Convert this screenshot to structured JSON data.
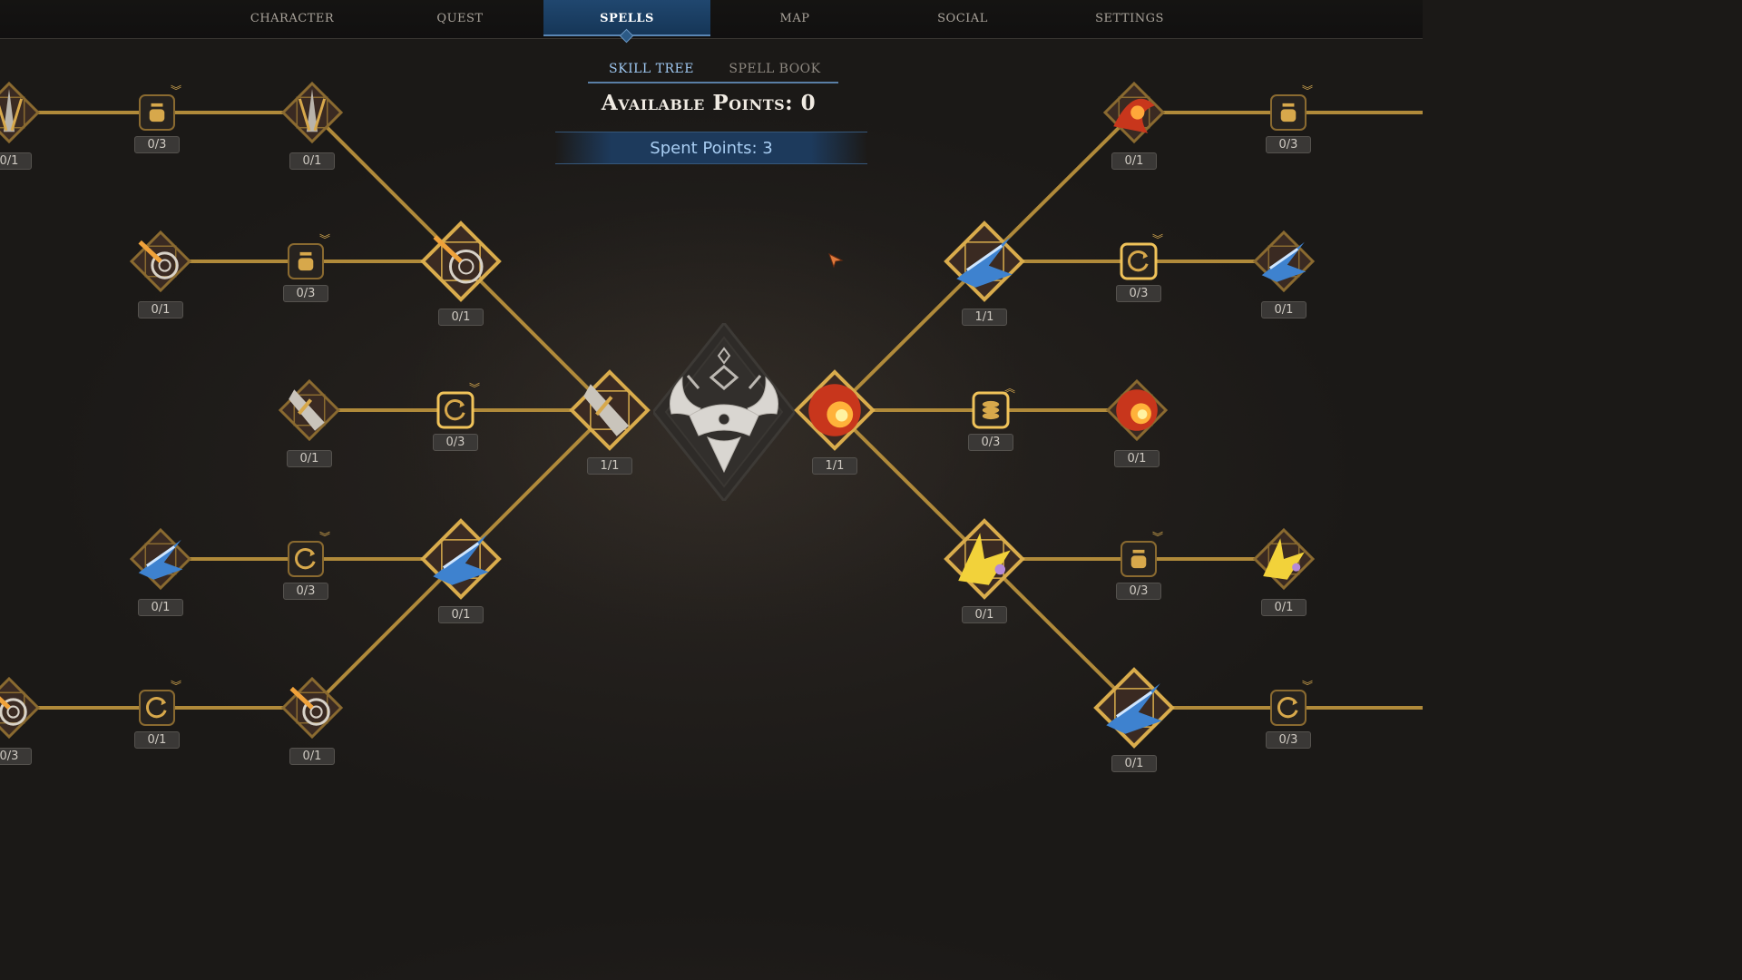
{
  "nav": {
    "tabs": [
      {
        "label": "CHARACTER",
        "active": false
      },
      {
        "label": "QUEST",
        "active": false
      },
      {
        "label": "SPELLS",
        "active": true
      },
      {
        "label": "MAP",
        "active": false
      },
      {
        "label": "SOCIAL",
        "active": false
      },
      {
        "label": "SETTINGS",
        "active": false
      }
    ]
  },
  "subtabs": [
    {
      "label": "SKILL TREE",
      "active": true
    },
    {
      "label": "SPELL BOOK",
      "active": false
    }
  ],
  "points": {
    "available_label": "Available Points: 0",
    "spent_label": "Spent Points: 3"
  },
  "colors": {
    "active_tab": "#1d3f63",
    "link": "#b08a3a",
    "gold": "#d7a84b",
    "fire": "#c8361c",
    "ice": "#3e82cf"
  },
  "nodes": {
    "l_top_edge": {
      "count": "0/1",
      "icon": "blade-spikes-icon"
    },
    "l_top_passive": {
      "count": "0/3",
      "icon": "potion-icon"
    },
    "l_top_spell": {
      "count": "0/1",
      "icon": "blade-spikes-icon"
    },
    "l_r2_spell": {
      "count": "0/1",
      "icon": "whirlwind-strike-icon"
    },
    "l_r2_passive": {
      "count": "0/3",
      "icon": "potion-icon"
    },
    "l_r2_main": {
      "count": "0/1",
      "icon": "whirlwind-strike-icon"
    },
    "l_r3_spell": {
      "count": "0/1",
      "icon": "shield-blade-icon"
    },
    "l_r3_passive": {
      "count": "0/3",
      "icon": "cooldown-icon"
    },
    "l_r3_main": {
      "count": "1/1",
      "icon": "holy-sword-icon"
    },
    "l_r4_spell": {
      "count": "0/1",
      "icon": "ice-shards-icon"
    },
    "l_r4_passive": {
      "count": "0/3",
      "icon": "cooldown-icon"
    },
    "l_r4_main": {
      "count": "0/1",
      "icon": "ice-shards-icon"
    },
    "l_bot_edge": {
      "count": "0/3",
      "icon": "whirl-icon"
    },
    "l_bot_passive": {
      "count": "0/1",
      "icon": "cooldown-icon"
    },
    "l_bot_spell": {
      "count": "0/1",
      "icon": "whirl-icon"
    },
    "r_top_spell": {
      "count": "0/1",
      "icon": "dragon-fire-icon"
    },
    "r_top_passive": {
      "count": "0/3",
      "icon": "potion-icon"
    },
    "r_r2_main": {
      "count": "1/1",
      "icon": "frost-wave-icon"
    },
    "r_r2_passive": {
      "count": "0/3",
      "icon": "cooldown-icon"
    },
    "r_r2_spell": {
      "count": "0/1",
      "icon": "frost-wave-icon"
    },
    "r_r3_main": {
      "count": "1/1",
      "icon": "fireball-icon"
    },
    "r_r3_passive": {
      "count": "0/3",
      "icon": "coins-icon"
    },
    "r_r3_spell": {
      "count": "0/1",
      "icon": "fireball-icon"
    },
    "r_r4_main": {
      "count": "0/1",
      "icon": "lightning-burst-icon"
    },
    "r_r4_passive": {
      "count": "0/3",
      "icon": "potion-icon"
    },
    "r_r4_spell": {
      "count": "0/1",
      "icon": "lightning-burst-icon"
    },
    "r_bot_spell": {
      "count": "0/1",
      "icon": "ice-claw-icon"
    },
    "r_bot_passive": {
      "count": "0/3",
      "icon": "cooldown-icon"
    }
  }
}
